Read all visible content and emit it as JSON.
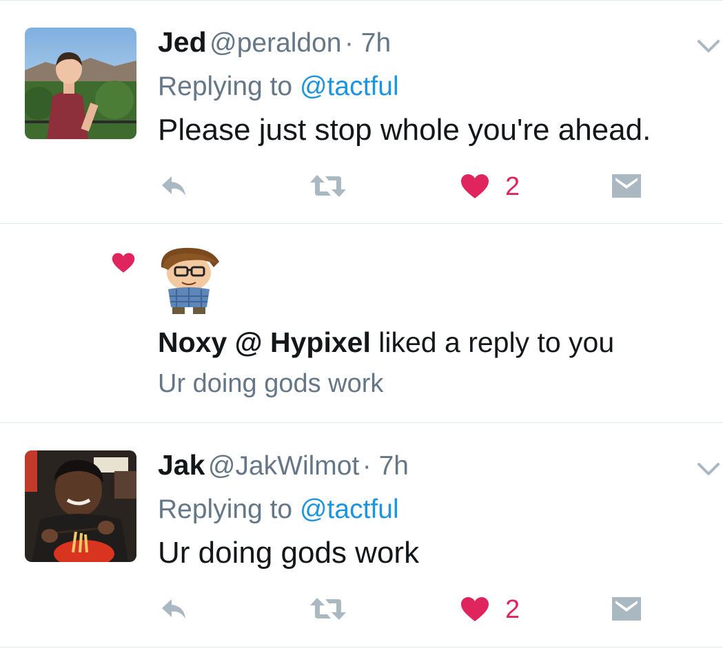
{
  "tweets": [
    {
      "name": "Jed",
      "handle": "@peraldon",
      "time": "· 7h",
      "replying_prefix": "Replying to",
      "replying_to": "@tactful",
      "text": "Please just stop whole you're ahead.",
      "like_count": "2"
    },
    {
      "name": "Jak",
      "handle": "@JakWilmot",
      "time": "· 7h",
      "replying_prefix": "Replying to",
      "replying_to": "@tactful",
      "text": "Ur doing gods work",
      "like_count": "2"
    }
  ],
  "notification": {
    "actor": "Noxy @ Hypixel",
    "action": "liked a reply to you",
    "snippet": "Ur doing gods work",
    "icon": "heart-icon"
  },
  "colors": {
    "accent": "#1b95e0",
    "like": "#e0245e",
    "muted": "#657786",
    "action_gray": "#aab8c2",
    "divider": "#e1e8ed"
  },
  "icons": [
    "reply-icon",
    "retweet-icon",
    "heart-icon",
    "message-icon",
    "chevron-down-icon"
  ]
}
